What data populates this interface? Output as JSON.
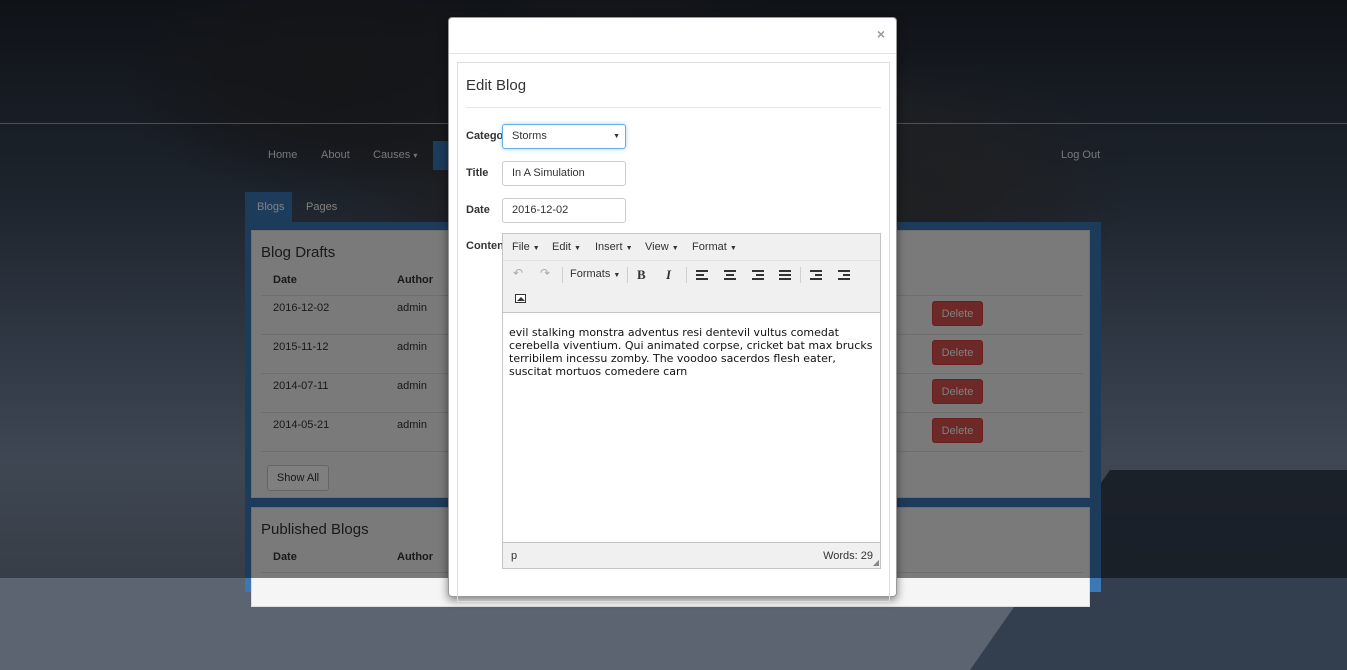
{
  "nav": {
    "items": [
      "Home",
      "About",
      "Causes"
    ],
    "causes_caret": "▾",
    "logout": "Log Out"
  },
  "tabs": [
    "Blogs",
    "Pages"
  ],
  "drafts": {
    "title": "Blog Drafts",
    "columns": [
      "Date",
      "Author"
    ],
    "rows": [
      {
        "date": "2016-12-02",
        "author": "admin"
      },
      {
        "date": "2015-11-12",
        "author": "admin"
      },
      {
        "date": "2014-07-11",
        "author": "admin"
      },
      {
        "date": "2014-05-21",
        "author": "admin"
      }
    ],
    "delete_label": "Delete",
    "show_all_label": "Show All"
  },
  "published": {
    "title": "Published Blogs",
    "columns": [
      "Date",
      "Author"
    ]
  },
  "modal": {
    "close": "×",
    "title": "Edit Blog",
    "labels": {
      "category": "Category",
      "title": "Title",
      "date": "Date",
      "content": "Content"
    },
    "category_value": "Storms",
    "title_value": "In A Simulation",
    "date_value": "2016-12-02",
    "editor": {
      "menus": [
        "File",
        "Edit",
        "Insert",
        "View",
        "Format"
      ],
      "formats_label": "Formats",
      "bold": "B",
      "italic": "I",
      "content": "evil stalking monstra adventus resi dentevil vultus comedat cerebella viventium. Qui animated corpse, cricket bat max brucks terribilem incessu zomby. The voodoo sacerdos flesh eater, suscitat mortuos comedere carn",
      "status_path": "p",
      "word_count": "Words: 29"
    }
  }
}
